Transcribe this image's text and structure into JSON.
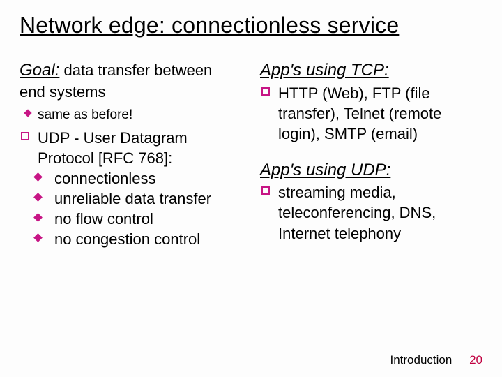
{
  "title": "Network edge: connectionless service",
  "left": {
    "goal_label": "Goal:",
    "goal_rest": " data transfer between end systems",
    "goal_sub": "same as before!",
    "udp_head": "UDP - User Datagram Protocol [RFC 768]:",
    "udp_items": {
      "a": "connectionless",
      "b": "unreliable data transfer",
      "c": "no flow control",
      "d": "no congestion control"
    }
  },
  "right": {
    "tcp_head": "App's using TCP:",
    "tcp_body": "HTTP (Web), FTP (file transfer), Telnet (remote login), SMTP (email)",
    "udp_head": "App's using UDP:",
    "udp_body": "streaming media, teleconferencing, DNS, Internet telephony"
  },
  "footer": {
    "section": "Introduction",
    "page": "20"
  }
}
